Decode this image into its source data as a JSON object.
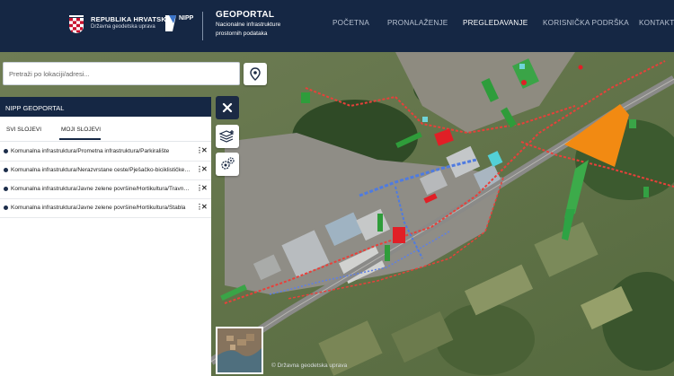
{
  "header": {
    "org_name": "REPUBLIKA HRVATSKA",
    "org_sub": "Državna geodetska uprava",
    "nipp_logo": "NIPP",
    "app_title": "GEOPORTAL",
    "app_sub_line1": "Nacionalne infrastrukture",
    "app_sub_line2": "prostornih podataka",
    "nav": [
      {
        "label": "POČETNA",
        "active": false
      },
      {
        "label": "PRONALAŽENJE",
        "active": false
      },
      {
        "label": "PREGLEDAVANJE",
        "active": true
      },
      {
        "label": "KORISNIČKA PODRŠKA",
        "active": false
      },
      {
        "label": "KONTAKT",
        "active": false
      }
    ]
  },
  "search": {
    "placeholder": "Pretraži po lokaciji/adresi...",
    "value": ""
  },
  "panel": {
    "title": "NIPP GEOPORTAL",
    "tabs": [
      {
        "label": "SVI SLOJEVI",
        "active": false
      },
      {
        "label": "MOJI SLOJEVI",
        "active": true
      }
    ],
    "layers": [
      {
        "label": "Komunalna infrastruktura/Prometna infrastruktura/Parkiralište"
      },
      {
        "label": "Komunalna infrastruktura/Nerazvrstane ceste/Pješačko-biciklističke staze"
      },
      {
        "label": "Komunalna infrastruktura/Javne zelene površine/Hortikultura/Travnjaci"
      },
      {
        "label": "Komunalna infrastruktura/Javne zelene površine/Hortikultura/Stabla"
      }
    ],
    "more_icon": "⋮",
    "remove_icon": "✕"
  },
  "tools": {
    "close_icon": "close-icon",
    "layers_icon": "layers-add-icon",
    "settings_icon": "gears-icon"
  },
  "map": {
    "credit": "© Državna geodetska uprava"
  },
  "colors": {
    "header_bg": "#152744",
    "highlight_orange": "#f28a12",
    "road_red": "#e8403a"
  }
}
